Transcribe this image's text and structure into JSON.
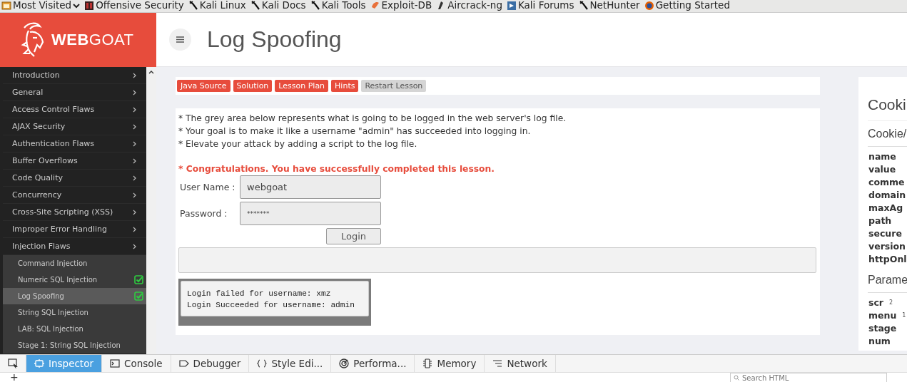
{
  "bookmarks": [
    {
      "label": "Most Visited",
      "kind": "folder"
    },
    {
      "label": "Offensive Security",
      "kind": "offsec"
    },
    {
      "label": "Kali Linux",
      "kind": "kali"
    },
    {
      "label": "Kali Docs",
      "kind": "kali"
    },
    {
      "label": "Kali Tools",
      "kind": "kali"
    },
    {
      "label": "Exploit-DB",
      "kind": "exploit"
    },
    {
      "label": "Aircrack-ng",
      "kind": "aircrack"
    },
    {
      "label": "Kali Forums",
      "kind": "forums"
    },
    {
      "label": "NetHunter",
      "kind": "kali"
    },
    {
      "label": "Getting Started",
      "kind": "firefox"
    }
  ],
  "logo": {
    "bold": "WEB",
    "light": "GOAT"
  },
  "page_title": "Log Spoofing",
  "sidebar": {
    "items": [
      {
        "label": "Introduction"
      },
      {
        "label": "General"
      },
      {
        "label": "Access Control Flaws"
      },
      {
        "label": "AJAX Security"
      },
      {
        "label": "Authentication Flaws"
      },
      {
        "label": "Buffer Overflows"
      },
      {
        "label": "Code Quality"
      },
      {
        "label": "Concurrency"
      },
      {
        "label": "Cross-Site Scripting (XSS)"
      },
      {
        "label": "Improper Error Handling"
      },
      {
        "label": "Injection Flaws",
        "children": [
          {
            "label": "Command Injection",
            "completed": false,
            "selected": false
          },
          {
            "label": "Numeric SQL Injection",
            "completed": true,
            "selected": false
          },
          {
            "label": "Log Spoofing",
            "completed": true,
            "selected": true
          },
          {
            "label": "String SQL Injection",
            "completed": false,
            "selected": false
          },
          {
            "label": "LAB: SQL Injection",
            "completed": false,
            "selected": false
          },
          {
            "label": "Stage 1: String SQL Injection",
            "completed": false,
            "selected": false
          }
        ]
      }
    ]
  },
  "lesson_buttons": [
    {
      "label": "Java Source",
      "kind": "primary"
    },
    {
      "label": "Solution",
      "kind": "primary"
    },
    {
      "label": "Lesson Plan",
      "kind": "primary"
    },
    {
      "label": "Hints",
      "kind": "primary"
    },
    {
      "label": "Restart Lesson",
      "kind": "secondary"
    }
  ],
  "instructions": [
    "* The grey area below represents what is going to be logged in the web server's log file.",
    "* Your goal is to make it like a username \"admin\" has succeeded into logging in.",
    "* Elevate your attack by adding a script to the log file."
  ],
  "success_message": "* Congratulations. You have successfully completed this lesson.",
  "form": {
    "fields": [
      {
        "label": "User Name :",
        "value": "webgoat",
        "kind": "text"
      },
      {
        "label": "Password :",
        "value": "*******",
        "kind": "password"
      }
    ],
    "submit": "Login"
  },
  "log_lines": [
    "Login failed for username: xmz",
    "Login Succeeded for username: admin"
  ],
  "cookie_panel": {
    "title": "Cooki",
    "subtitle": "Cookie/",
    "cookie_rows": [
      "name",
      "value",
      "comme",
      "domain",
      "maxAg",
      "path",
      "secure",
      "version",
      "httpOnl"
    ],
    "params_title": "Parame",
    "param_rows": [
      {
        "key": "scr",
        "value": "2"
      },
      {
        "key": "menu",
        "value": "1"
      },
      {
        "key": "stage"
      },
      {
        "key": "num"
      }
    ]
  },
  "devtools": {
    "tabs": [
      {
        "kind": "picker",
        "selected": false
      },
      {
        "label": "Inspector",
        "kind": "inspector",
        "selected": true
      },
      {
        "label": "Console",
        "kind": "console",
        "selected": false
      },
      {
        "label": "Debugger",
        "kind": "debugger",
        "selected": false
      },
      {
        "label": "Style Edi...",
        "kind": "style",
        "selected": false
      },
      {
        "label": "Performa...",
        "kind": "performance",
        "selected": false
      },
      {
        "label": "Memory",
        "kind": "memory",
        "selected": false
      },
      {
        "label": "Network",
        "kind": "network",
        "selected": false
      }
    ],
    "add": "+",
    "search": {
      "placeholder": "Search HTML"
    }
  }
}
